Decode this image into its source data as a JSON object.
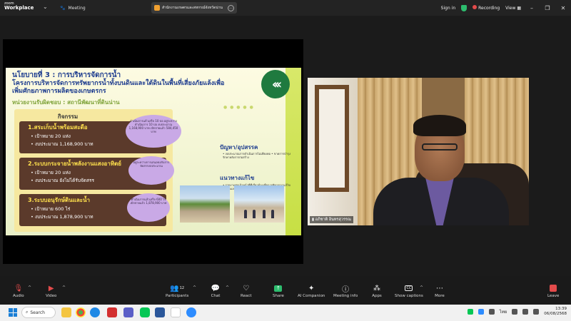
{
  "topbar": {
    "logo_line1": "zoom",
    "logo_line2": "Workplace",
    "meeting_label": "Meeting",
    "active_tab_title": "สำนักงานเกษตรและสหกรณ์จังหวัดน่าน",
    "sign_in": "Sign in",
    "recording": "Recording",
    "view": "View"
  },
  "slide": {
    "title": "นโยบายที่ 3 : การบริหารจัดการน้ำ",
    "subtitle": "โครงการบริหารจัดการทรัพยากรน้ำทั้งบนดินและใต้ดินในพื้นที่เสี่ยงภัยแล้งเพื่อเพิ่มศักยภาพการผลิตของเกษตรกร",
    "unit": "หน่วยงานรับผิดชอบ : สถานีพัฒนาที่ดินน่าน",
    "activity_head": "กิจกรรม",
    "activities": [
      {
        "title": "1.สระเก็บน้ำพร้อมสะดือ",
        "target": "• เป้าหมาย 20 แห่ง",
        "budget": "• งบประมาณ 1,168,900 บาท"
      },
      {
        "title": "2.ระบบกระจายน้ำพลังงานแสงอาทิตย์",
        "target": "• เป้าหมาย 20 แห่ง",
        "budget": "• งบประมาณ ยังไม่ได้รับจัดสรร"
      },
      {
        "title": "3.ระบบอนุรักษ์ดินและน้ำ",
        "target": "• เป้าหมาย 600 ไร่",
        "budget": "• งบประมาณ 1,878,900 บาท"
      }
    ],
    "bubbles": [
      "ดำเนินการแล้วเสร็จ 10 บ่อ อยู่ระหว่างดำเนินการ 10 บ่อ งบประมาณ 1,168,900 บาท เบิกจ่ายแล้ว 584,450 บาท",
      "อยู่ระหว่างการเสนอขอรับการจัดสรรงบประมาณ",
      "ดำเนินการแล้วเสร็จ 600 ไร่ เบิกจ่ายแล้ว 1,878,900 บาท"
    ],
    "problem_title": "ปัญหา/อุปสรรค",
    "problem_text": "• งบประมาณการดำเนินการไม่เพียงพอ • ขาดการบำรุงรักษาหลังการก่อสร้าง",
    "solution_title": "แนวทางแก้ไข",
    "solution_text": "• รายงานต่อเจ้าหน้าที่ที่เกี่ยวข้องเพื่อการพิจารณาแก้ไขปัญหาและอุปสรรคในการดำเนินงาน"
  },
  "participant": {
    "name": "อภิชาติ อินทรสุวรรณ"
  },
  "toolbar": {
    "audio": "Audio",
    "video": "Video",
    "participants": "Participants",
    "participants_count": "12",
    "chat": "Chat",
    "react": "React",
    "share": "Share",
    "ai_companion": "AI Companion",
    "meeting_info": "Meeting info",
    "apps": "Apps",
    "show_captions": "Show captions",
    "more": "More",
    "leave": "Leave"
  },
  "taskbar": {
    "search": "Search",
    "lang": "ไทย",
    "time": "13:39",
    "date": "06/08/2568"
  },
  "colors": {
    "accent_green": "#2dbd6e",
    "record_red": "#e34b4b",
    "slide_blue": "#1e3d8f"
  }
}
